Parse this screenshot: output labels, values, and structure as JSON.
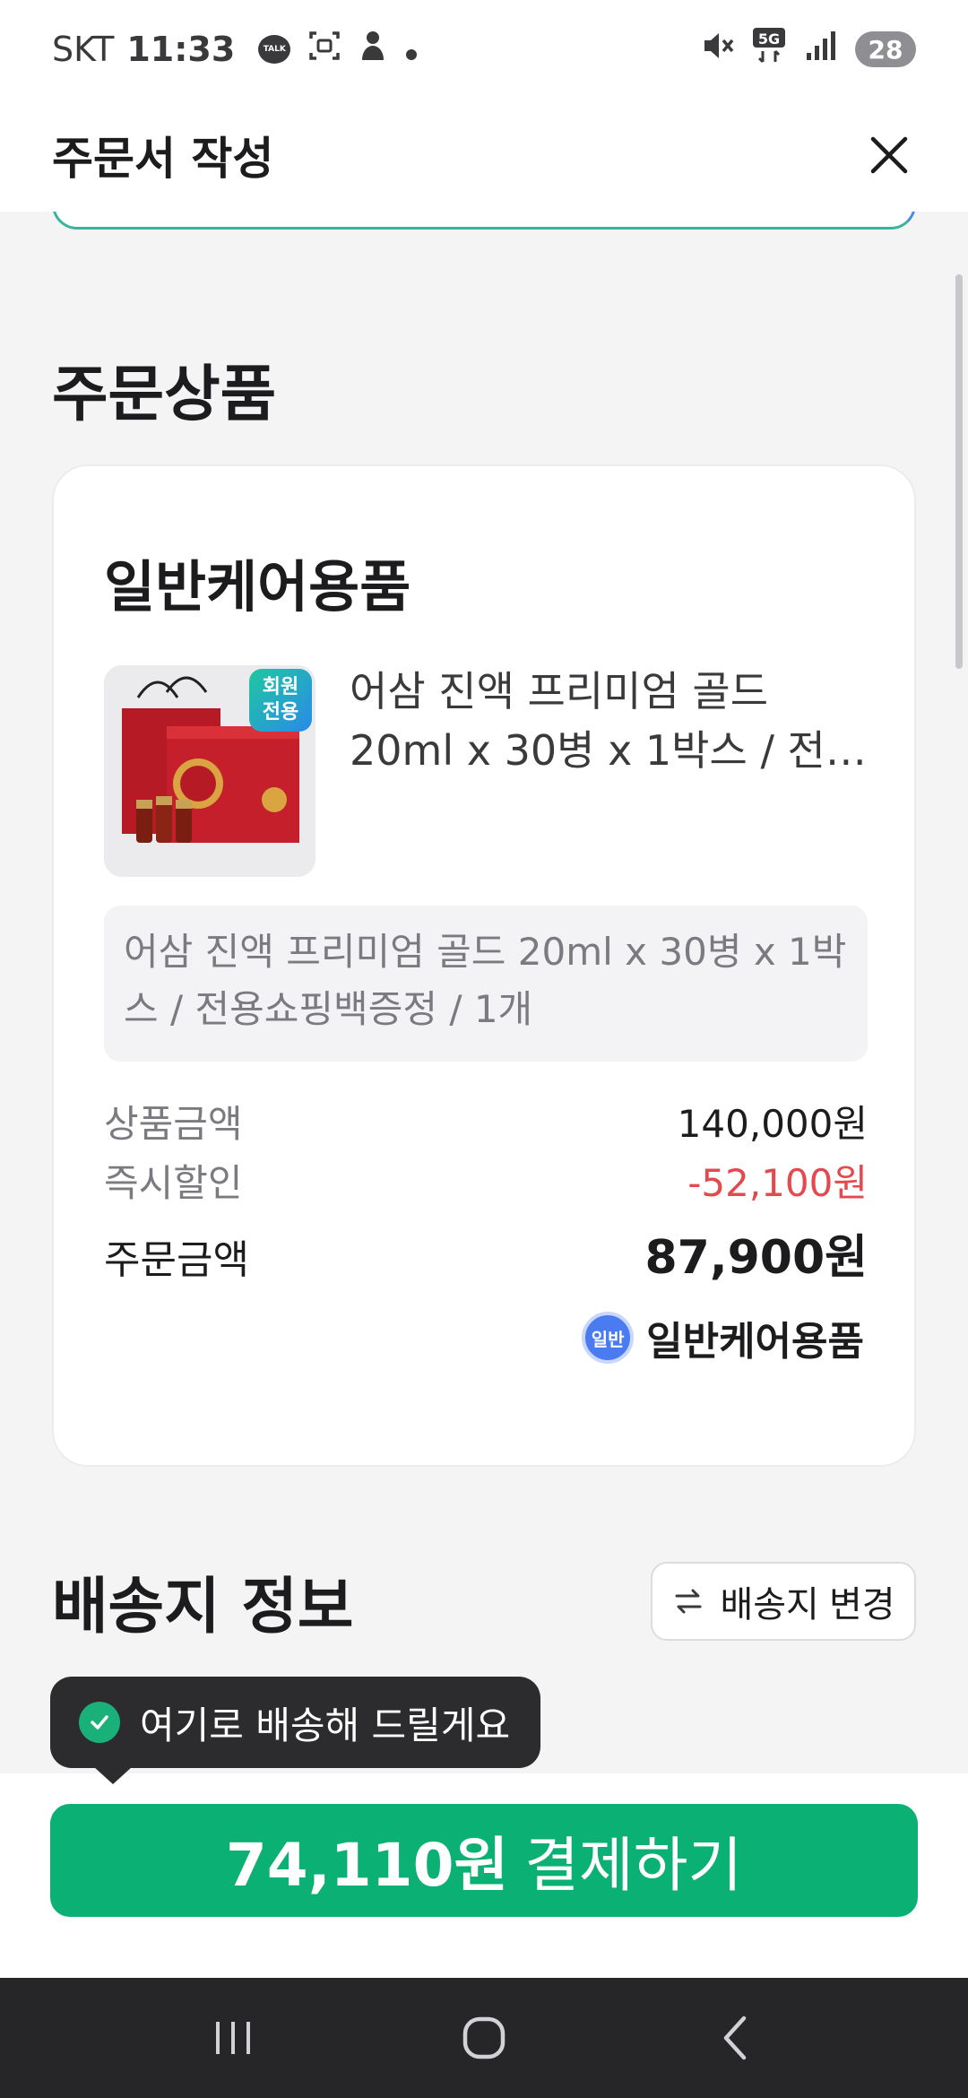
{
  "status_bar": {
    "carrier": "SKT",
    "time": "11:33",
    "talk_icon_text": "TALK",
    "network": "5G",
    "battery": "28"
  },
  "header": {
    "title": "주문서 작성"
  },
  "order_section": {
    "title": "주문상품",
    "card": {
      "category": "일반케어용품",
      "member_badge": "회원\n전용",
      "product_name": "어삼 진액 프리미엄 골드 20ml x 30병 x 1박스 / 전용쇼핑백증정",
      "product_name_display": "어삼 진액 프리미엄 골드 20ml x 30병 x 1박스 / 전…",
      "option_text": "어삼 진액 프리미엄 골드 20ml x 30병 x 1박스 / 전용쇼핑백증정 / 1개",
      "prices": {
        "product_label": "상품금액",
        "product_value": "140,000원",
        "discount_label": "즉시할인",
        "discount_value": "-52,100원",
        "total_label": "주문금액",
        "total_value": "87,900원"
      },
      "care_badge": "일반",
      "care_label": "일반케어용품"
    }
  },
  "shipping_section": {
    "title": "배송지 정보",
    "change_button": "배송지 변경",
    "tooltip": "여기로 배송해 드릴게요"
  },
  "payment": {
    "amount": "74,110원",
    "action": "결제하기"
  },
  "colors": {
    "accent_green": "#0bb074",
    "discount_red": "#e5484d",
    "badge_blue": "#4a7bf0"
  }
}
